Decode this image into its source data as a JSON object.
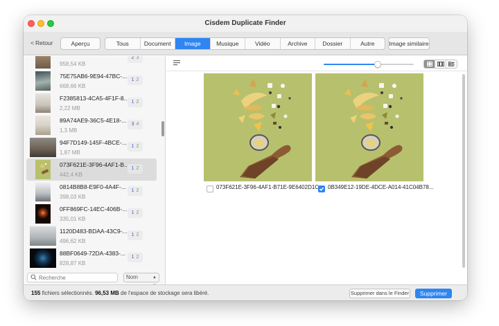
{
  "window": {
    "title": "Cisdem Duplicate Finder"
  },
  "toolbar": {
    "back_label": "Retour",
    "preview_label": "Aperçu",
    "similar_label": "Image similaire",
    "tabs": [
      "Tous",
      "Document",
      "Image",
      "Musique",
      "Vidéo",
      "Archive",
      "Dossier",
      "Autre"
    ],
    "active_tab": "Image"
  },
  "sidebar": {
    "items": [
      {
        "name": "",
        "size": "958,54 KB",
        "count_a": "2",
        "count_b": "3"
      },
      {
        "name": "75E75AB6-9E94-47BC-...",
        "size": "668,66 KB",
        "count_a": "1",
        "count_b": "2"
      },
      {
        "name": "F2385813-4CA5-4F1F-8...",
        "size": "2,22 MB",
        "count_a": "1",
        "count_b": "2"
      },
      {
        "name": "89A74AE9-36C5-4E18-...",
        "size": "1,3 MB",
        "count_a": "3",
        "count_b": "4"
      },
      {
        "name": "94F7D149-145F-4BCE-...",
        "size": "1,87 MB",
        "count_a": "1",
        "count_b": "2"
      },
      {
        "name": "073F621E-3F96-4AF1-B...",
        "size": "442,4 KB",
        "count_a": "1",
        "count_b": "2"
      },
      {
        "name": "0814B8B8-E9F0-4A4F-...",
        "size": "398,03 KB",
        "count_a": "1",
        "count_b": "2"
      },
      {
        "name": "0FF869FC-14EC-406B-...",
        "size": "335,01 KB",
        "count_a": "1",
        "count_b": "2"
      },
      {
        "name": "1120D483-BDAA-43C9-...",
        "size": "496,62 KB",
        "count_a": "1",
        "count_b": "2"
      },
      {
        "name": "88BF0649-72DA-4383-...",
        "size": "828,87 KB",
        "count_a": "1",
        "count_b": "2"
      }
    ],
    "selected_index": 5,
    "search_placeholder": "Recherche",
    "sort_value": "Nom"
  },
  "preview": {
    "zoom_level": 0.6,
    "files": [
      {
        "name": "073F621E-3F96-4AF1-B71E-9E6402D1C...",
        "checked": false
      },
      {
        "name": "0B349E12-19DE-4DCE-A014-41C04B78...",
        "checked": true
      }
    ]
  },
  "status": {
    "count": "155",
    "count_text": "fichiers sélectionnés.",
    "size": "96,53 MB",
    "size_text": "de l'espace de stockage sera libéré.",
    "finder_button": "Supprimer dans le Finder",
    "delete_button": "Supprimer"
  },
  "colors": {
    "accent": "#2f85f1",
    "selection": "#dcdcdc",
    "photo_bg": "#b7c06d"
  },
  "icons": [
    "search-icon",
    "list-view-icon",
    "grid-view-icon",
    "compare-view-icon",
    "detail-view-icon",
    "check-icon",
    "chevron-left-icon",
    "updown-icon"
  ]
}
